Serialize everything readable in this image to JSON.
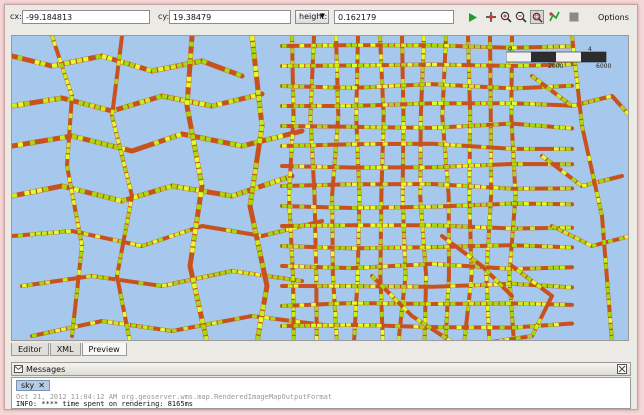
{
  "toolbar": {
    "cx_label": "cx:",
    "cx_value": "-99.184813",
    "cy_label": "cy:",
    "cy_value": "19.38479",
    "mode_select": "height:",
    "mode_value": "0.162179",
    "options_label": "Options",
    "icons": [
      "play-icon",
      "pan-icon",
      "zoom-in-icon",
      "zoom-out-icon",
      "zoom-box-icon",
      "query-icon",
      "stop-icon"
    ]
  },
  "map": {
    "colors": {
      "water": "#a6c8ec",
      "land": "#a6c8ec",
      "road_high": "#c8521e",
      "road_mid": "#a8d810",
      "road_low": "#c4f020",
      "road_peak": "#e0ff30"
    },
    "scalebar": {
      "tick_start": "0",
      "tick_mid": "2000",
      "tick_end": "6000",
      "tick_right": "4"
    }
  },
  "editor_tabs": [
    "Editor",
    "XML",
    "Preview"
  ],
  "editor_tabs_selected": "Preview",
  "messages": {
    "title": "Messages",
    "tab_label": "sky",
    "log_lines": [
      "Oct 21, 2012 11:04:12 AM org.geoserver.wms.map.RenderedImageMapOutputFormat",
      "INFO: **** time spent on rendering: 8165ms"
    ]
  }
}
